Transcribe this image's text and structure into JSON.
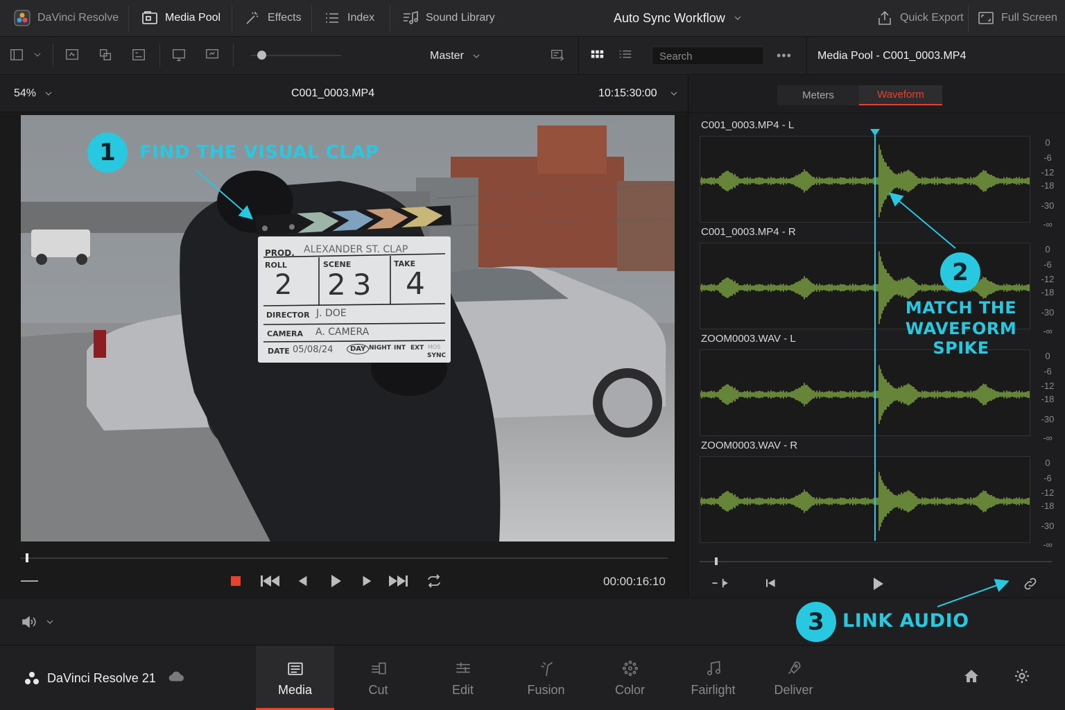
{
  "topbar": {
    "app_name": "DaVinci Resolve",
    "media_pool": "Media Pool",
    "effects": "Effects",
    "index": "Index",
    "sound_library": "Sound Library",
    "project_title": "Auto Sync Workflow",
    "quick_export": "Quick Export",
    "full_screen": "Full Screen"
  },
  "toolbar": {
    "bin": "Master",
    "search_placeholder": "Search",
    "more": "•••",
    "panel_title": "Media Pool - C001_0003.MP4"
  },
  "viewer": {
    "zoom": "54%",
    "clip_name": "C001_0003.MP4",
    "timecode": "10:15:30:00",
    "duration": "00:00:16:10",
    "playhead_position": 0.008
  },
  "slate": {
    "prod_label": "PROD.",
    "prod_value": "ALEXANDER ST. CLAP",
    "roll_label": "ROLL",
    "roll_value": "2",
    "scene_label": "SCENE",
    "scene_value": "23",
    "take_label": "TAKE",
    "take_value": "4",
    "director_label": "DIRECTOR",
    "director_value": "J. DOE",
    "camera_label": "CAMERA",
    "camera_value": "A. CAMERA",
    "date_label": "DATE",
    "date_value": "05/08/24",
    "day": "DAY",
    "night": "NIGHT",
    "int": "INT",
    "ext": "EXT",
    "mos": "MOS",
    "sync": "SYNC"
  },
  "audio_panel": {
    "tabs": [
      "Meters",
      "Waveform"
    ],
    "active_tab": "Waveform",
    "accent": "#e8412e",
    "waveform_color": "#7aa041",
    "playhead_color": "#27c8e0",
    "db_scale": [
      "0",
      "-6",
      "-12",
      "-18",
      "-30",
      "-∞"
    ],
    "tracks": [
      {
        "label": "C001_0003.MP4 - L"
      },
      {
        "label": "C001_0003.MP4 - R"
      },
      {
        "label": "ZOOM0003.WAV - L"
      },
      {
        "label": "ZOOM0003.WAV - R"
      }
    ]
  },
  "callouts": {
    "step1_num": "1",
    "step1_text": "FIND THE VISUAL CLAP",
    "step2_num": "2",
    "step2_line1": "MATCH THE",
    "step2_line2": "WAVEFORM SPIKE",
    "step3_num": "3",
    "step3_text": "LINK AUDIO",
    "color": "#27c8e0"
  },
  "footer": {
    "brand": "DaVinci Resolve 21",
    "pages": [
      "Media",
      "Cut",
      "Edit",
      "Fusion",
      "Color",
      "Fairlight",
      "Deliver"
    ],
    "active_page": "Media"
  }
}
